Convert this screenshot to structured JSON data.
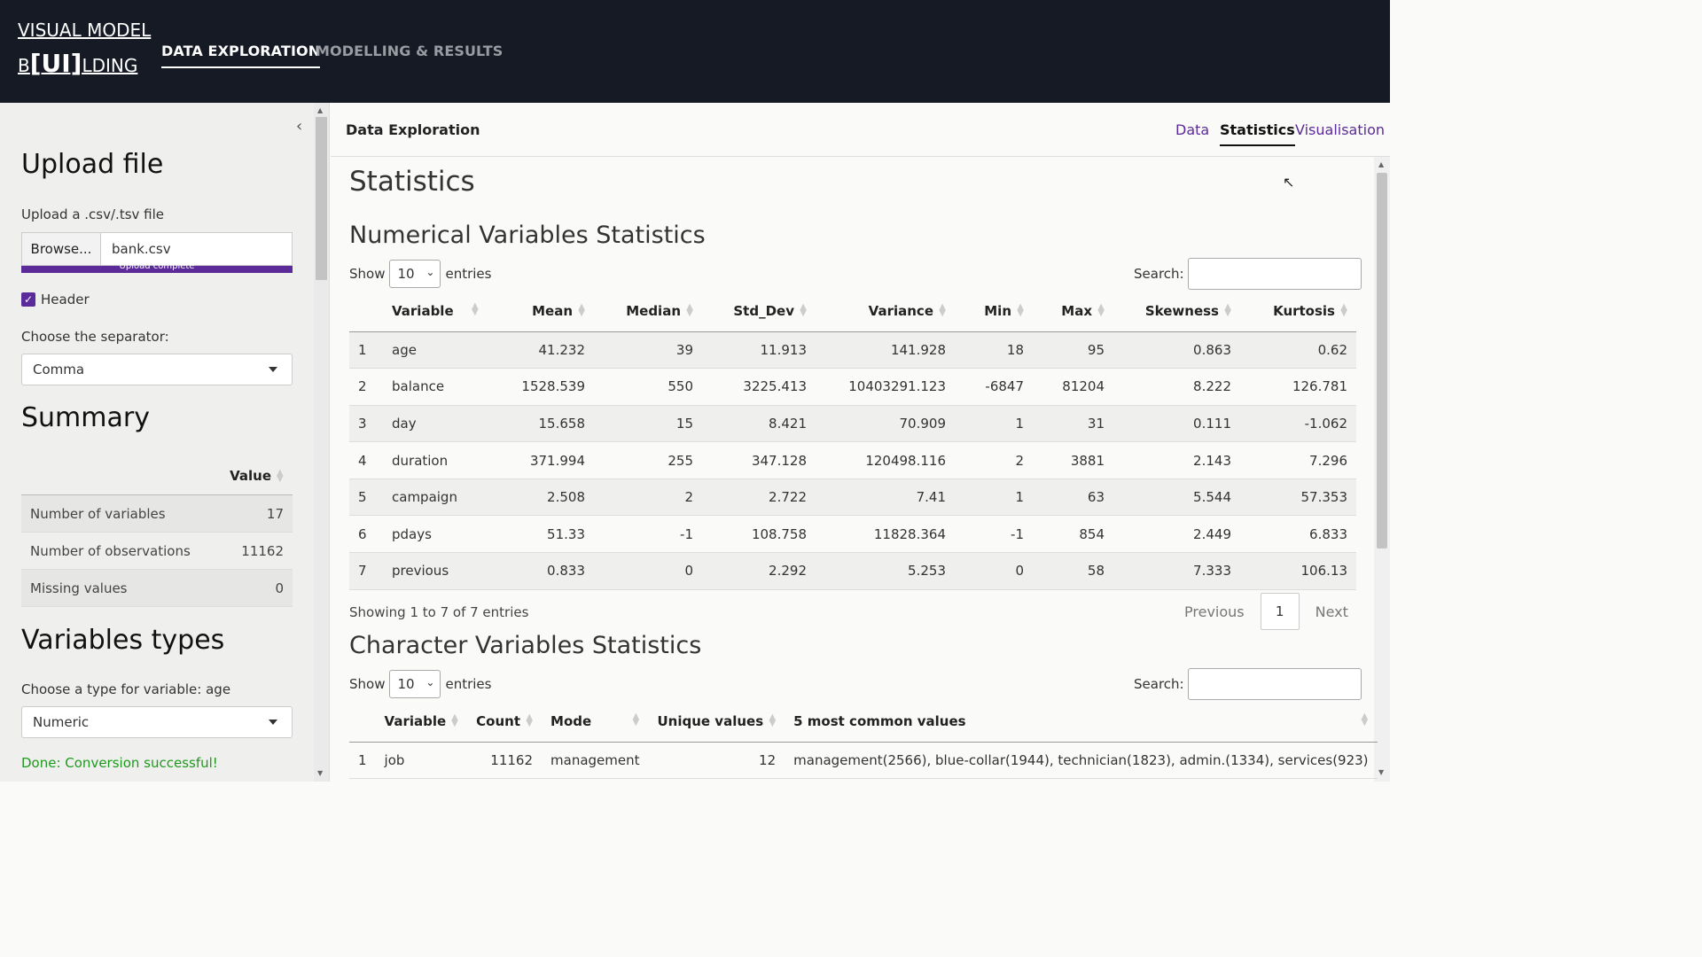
{
  "brand": {
    "line1": "VISUAL MODEL",
    "line2_pre": "B",
    "line2_bold": "[UI]",
    "line2_post": "LDING"
  },
  "nav": {
    "data_exploration": "DATA EXPLORATION",
    "modelling": "MODELLING & RESULTS"
  },
  "sidebar": {
    "upload_title": "Upload file",
    "upload_label": "Upload a .csv/.tsv file",
    "browse_label": "Browse...",
    "file_name": "bank.csv",
    "upload_status": "Upload complete",
    "header_label": "Header",
    "separator_label": "Choose the separator:",
    "separator_value": "Comma",
    "summary_title": "Summary",
    "summary_col": "Value",
    "summary_rows": [
      {
        "label": "Number of variables",
        "value": "17"
      },
      {
        "label": "Number of observations",
        "value": "11162"
      },
      {
        "label": "Missing values",
        "value": "0"
      }
    ],
    "types_title": "Variables types",
    "type_label": "Choose a type for variable: age",
    "type_value": "Numeric",
    "success_msg": "Done: Conversion successful!"
  },
  "main": {
    "title": "Data Exploration",
    "tabs": {
      "data": "Data",
      "statistics": "Statistics",
      "visualisation": "Visualisation"
    },
    "page_title": "Statistics",
    "num_title": "Numerical Variables Statistics",
    "show": "Show",
    "entries_value": "10",
    "entries": "entries",
    "search": "Search:",
    "num_columns": [
      "Variable",
      "Mean",
      "Median",
      "Std_Dev",
      "Variance",
      "Min",
      "Max",
      "Skewness",
      "Kurtosis"
    ],
    "num_rows": [
      [
        "1",
        "age",
        "41.232",
        "39",
        "11.913",
        "141.928",
        "18",
        "95",
        "0.863",
        "0.62"
      ],
      [
        "2",
        "balance",
        "1528.539",
        "550",
        "3225.413",
        "10403291.123",
        "-6847",
        "81204",
        "8.222",
        "126.781"
      ],
      [
        "3",
        "day",
        "15.658",
        "15",
        "8.421",
        "70.909",
        "1",
        "31",
        "0.111",
        "-1.062"
      ],
      [
        "4",
        "duration",
        "371.994",
        "255",
        "347.128",
        "120498.116",
        "2",
        "3881",
        "2.143",
        "7.296"
      ],
      [
        "5",
        "campaign",
        "2.508",
        "2",
        "2.722",
        "7.41",
        "1",
        "63",
        "5.544",
        "57.353"
      ],
      [
        "6",
        "pdays",
        "51.33",
        "-1",
        "108.758",
        "11828.364",
        "-1",
        "854",
        "2.449",
        "6.833"
      ],
      [
        "7",
        "previous",
        "0.833",
        "0",
        "2.292",
        "5.253",
        "0",
        "58",
        "7.333",
        "106.13"
      ]
    ],
    "num_info": "Showing 1 to 7 of 7 entries",
    "pager": {
      "prev": "Previous",
      "page": "1",
      "next": "Next"
    },
    "char_title": "Character Variables Statistics",
    "char_columns": [
      "Variable",
      "Count",
      "Mode",
      "Unique values",
      "5 most common values"
    ],
    "char_rows": [
      [
        "1",
        "job",
        "11162",
        "management",
        "12",
        "management(2566), blue-collar(1944), technician(1823), admin.(1334), services(923)"
      ]
    ]
  }
}
